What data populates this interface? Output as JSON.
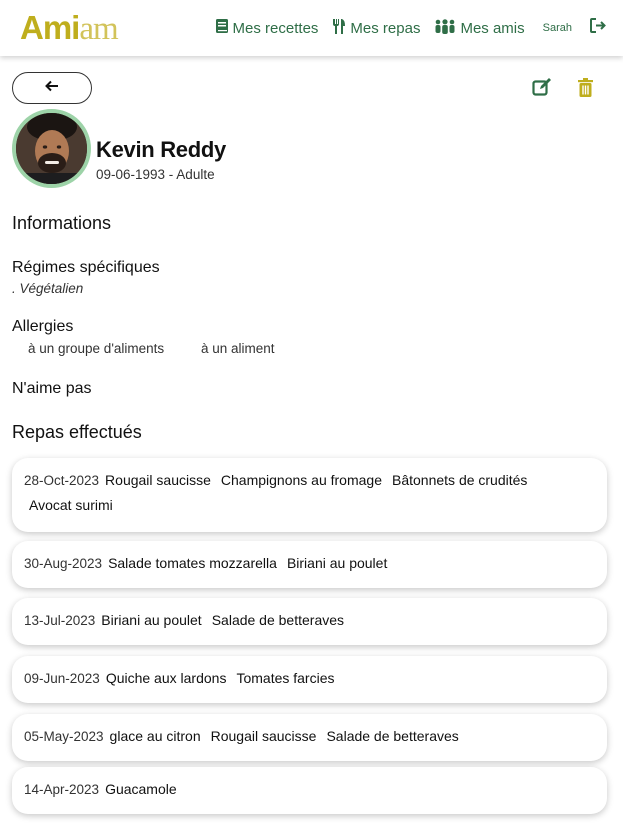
{
  "brand": {
    "logo_part1": "Ami",
    "logo_part2": "am",
    "accent": "#bfae1d",
    "nav_color": "#2f6e47"
  },
  "nav": {
    "recipes_label": "Mes recettes",
    "meals_label": "Mes repas",
    "friends_label": "Mes amis",
    "user_name": "Sarah"
  },
  "toolbar": {
    "back_icon": "arrow-left-icon",
    "edit_icon": "edit-icon",
    "delete_icon": "trash-icon"
  },
  "profile": {
    "name": "Kevin Reddy",
    "subtitle": "09-06-1993 - Adulte"
  },
  "sections": {
    "informations": "Informations",
    "diets_title": "Régimes spécifiques",
    "diet_item": ". Végétalien",
    "allergies_title": "Allergies",
    "allergy_group": "à un groupe d'aliments",
    "allergy_food": "à un aliment",
    "dislikes_title": "N'aime pas",
    "meals_title": "Repas effectués"
  },
  "meals": [
    {
      "date": "28-Oct-2023",
      "dishes": [
        "Rougail saucisse",
        "Champignons au fromage",
        "Bâtonnets de crudités",
        "Avocat surimi"
      ]
    },
    {
      "date": "30-Aug-2023",
      "dishes": [
        "Salade tomates mozzarella",
        "Biriani au poulet"
      ]
    },
    {
      "date": "13-Jul-2023",
      "dishes": [
        "Biriani au poulet",
        "Salade de betteraves"
      ]
    },
    {
      "date": "09-Jun-2023",
      "dishes": [
        "Quiche aux lardons",
        "Tomates farcies"
      ]
    },
    {
      "date": "05-May-2023",
      "dishes": [
        "glace au citron",
        "Rougail saucisse",
        "Salade de betteraves"
      ]
    },
    {
      "date": "14-Apr-2023",
      "dishes": [
        "Guacamole"
      ]
    }
  ]
}
